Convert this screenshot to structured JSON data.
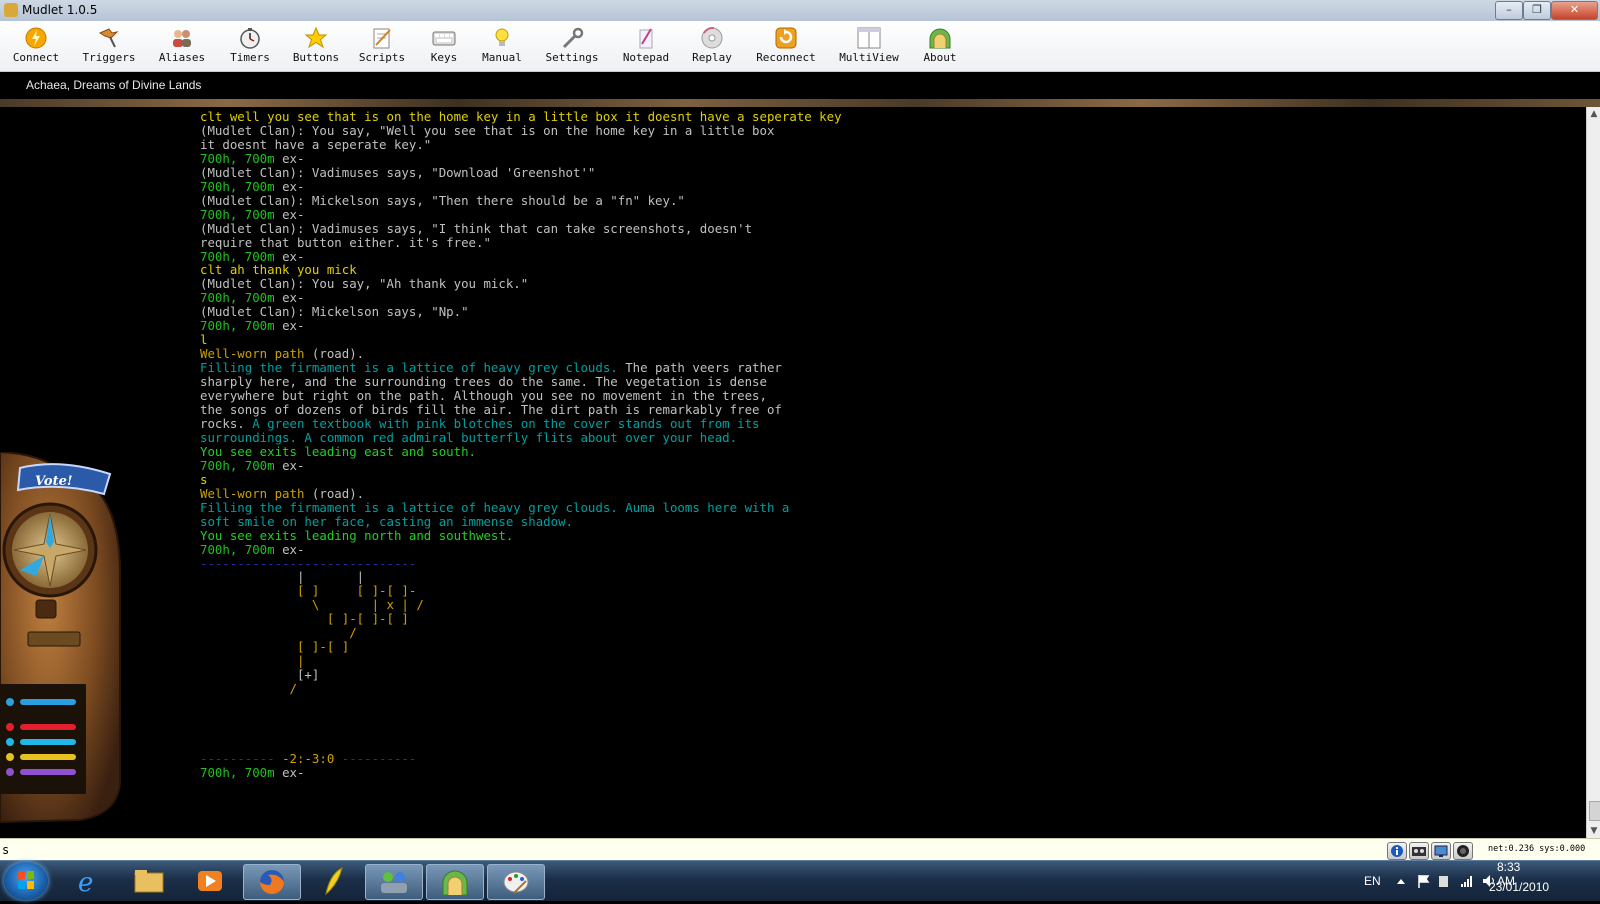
{
  "window": {
    "title": "Mudlet 1.0.5",
    "minimize": "–",
    "maximize": "❐",
    "close": "✕"
  },
  "toolbar": [
    {
      "label": "Connect",
      "icon": "connect-icon"
    },
    {
      "label": "Triggers",
      "icon": "triggers-icon"
    },
    {
      "label": "Aliases",
      "icon": "aliases-icon"
    },
    {
      "label": "Timers",
      "icon": "timers-icon"
    },
    {
      "label": "Buttons",
      "icon": "buttons-icon"
    },
    {
      "label": "Scripts",
      "icon": "scripts-icon"
    },
    {
      "label": "Keys",
      "icon": "keys-icon"
    },
    {
      "label": "Manual",
      "icon": "manual-icon"
    },
    {
      "label": "Settings",
      "icon": "settings-icon"
    },
    {
      "label": "Notepad",
      "icon": "notepad-icon"
    },
    {
      "label": "Replay",
      "icon": "replay-icon"
    },
    {
      "label": "Reconnect",
      "icon": "reconnect-icon"
    },
    {
      "label": "MultiView",
      "icon": "multiview-icon"
    },
    {
      "label": "About",
      "icon": "about-icon"
    }
  ],
  "session": {
    "tab": "Achaea, Dreams of Divine Lands"
  },
  "console": {
    "lines": [
      [
        [
          "y",
          "clt well you see that is on the home key in a little box it doesnt have a seperate key"
        ]
      ],
      [
        [
          "w",
          "(Mudlet Clan): You say, \"Well you see that is on the home key in a little box"
        ]
      ],
      [
        [
          "w",
          "it doesnt have a seperate key.\""
        ]
      ],
      [
        [
          "g",
          "700h, 700m "
        ],
        [
          "w",
          "ex-"
        ]
      ],
      [
        [
          "w",
          "(Mudlet Clan): Vadimuses says, \"Download 'Greenshot'\""
        ]
      ],
      [
        [
          "g",
          "700h, 700m "
        ],
        [
          "w",
          "ex-"
        ]
      ],
      [
        [
          "w",
          "(Mudlet Clan): Mickelson says, \"Then there should be a \"fn\" key.\""
        ]
      ],
      [
        [
          "g",
          "700h, 700m "
        ],
        [
          "w",
          "ex-"
        ]
      ],
      [
        [
          "w",
          "(Mudlet Clan): Vadimuses says, \"I think that can take screenshots, doesn't"
        ]
      ],
      [
        [
          "w",
          "require that button either. it's free.\""
        ]
      ],
      [
        [
          "g",
          "700h, 700m "
        ],
        [
          "w",
          "ex-"
        ]
      ],
      [
        [
          "y",
          "clt ah thank you mick"
        ]
      ],
      [
        [
          "w",
          "(Mudlet Clan): You say, \"Ah thank you mick.\""
        ]
      ],
      [
        [
          "g",
          "700h, 700m "
        ],
        [
          "w",
          "ex-"
        ]
      ],
      [
        [
          "w",
          "(Mudlet Clan): Mickelson says, \"Np.\""
        ]
      ],
      [
        [
          "g",
          "700h, 700m "
        ],
        [
          "w",
          "ex-"
        ]
      ],
      [
        [
          "y",
          "l"
        ]
      ],
      [
        [
          "gold",
          "Well-worn path "
        ],
        [
          "w",
          "(road)."
        ]
      ],
      [
        [
          "c",
          "Filling the firmament is a lattice of heavy grey clouds. "
        ],
        [
          "w",
          "The path veers rather"
        ]
      ],
      [
        [
          "w",
          "sharply here, and the surrounding trees do the same. The vegetation is dense"
        ]
      ],
      [
        [
          "w",
          "everywhere but right on the path. Although you see no movement in the trees,"
        ]
      ],
      [
        [
          "w",
          "the songs of dozens of birds fill the air. The dirt path is remarkably free of"
        ]
      ],
      [
        [
          "w",
          "rocks. "
        ],
        [
          "c",
          "A green textbook with pink blotches on the cover stands out from its"
        ]
      ],
      [
        [
          "c",
          "surroundings. A common red admiral butterfly flits about over your head."
        ]
      ],
      [
        [
          "bg",
          "You see exits leading east and south."
        ]
      ],
      [
        [
          "g",
          "700h, 700m "
        ],
        [
          "w",
          "ex-"
        ]
      ],
      [
        [
          "y",
          "s"
        ]
      ],
      [
        [
          "gold",
          "Well-worn path "
        ],
        [
          "w",
          "(road)."
        ]
      ],
      [
        [
          "c",
          "Filling the firmament is a lattice of heavy grey clouds. Auma looms here with a"
        ]
      ],
      [
        [
          "c",
          "soft smile on her face, casting an immense shadow."
        ]
      ],
      [
        [
          "bg",
          "You see exits leading north and southwest."
        ]
      ],
      [
        [
          "g",
          "700h, 700m "
        ],
        [
          "w",
          "ex-"
        ]
      ],
      [
        [
          "blue",
          "-----------------------------"
        ]
      ],
      [
        [
          "w",
          "             |       |"
        ]
      ],
      [
        [
          "o",
          "             [ ]     [ ]-[ ]-"
        ]
      ],
      [
        [
          "o",
          "               \\       | x | /"
        ]
      ],
      [
        [
          "o",
          "                 [ ]-[ ]-[ ]"
        ]
      ],
      [
        [
          "o",
          "                    /"
        ]
      ],
      [
        [
          "o",
          "             [ ]-[ ]"
        ]
      ],
      [
        [
          "o",
          "             |"
        ]
      ],
      [
        [
          "w",
          "             [+]"
        ]
      ],
      [
        [
          "o",
          "            /"
        ]
      ],
      [
        [
          "w",
          " "
        ]
      ],
      [
        [
          "w",
          " "
        ]
      ],
      [
        [
          "w",
          " "
        ]
      ],
      [
        [
          "w",
          " "
        ]
      ],
      [
        [
          "blue",
          "---------- "
        ],
        [
          "o",
          "-2:-3:0"
        ],
        [
          "blue",
          " ----------"
        ]
      ],
      [
        [
          "g",
          "700h, 700m "
        ],
        [
          "w",
          "ex-"
        ]
      ]
    ]
  },
  "widget": {
    "vote_label": "Vote!"
  },
  "input": {
    "value": "s"
  },
  "status": {
    "net": "net:0.236 sys:0.000"
  },
  "taskbar": {
    "lang": "EN",
    "time": "8:33 AM",
    "date": "23/01/2010",
    "apps": [
      "internet-explorer-icon",
      "file-explorer-icon",
      "media-player-icon",
      "firefox-icon",
      "feather-app-icon",
      "network-app-icon",
      "mudlet-icon",
      "paint-icon"
    ]
  },
  "colors": {
    "prompt": "#20c020",
    "echo": "#e0d000",
    "room_desc": "#00a0a0",
    "exits": "#20d020",
    "room_name": "#c8a000"
  }
}
